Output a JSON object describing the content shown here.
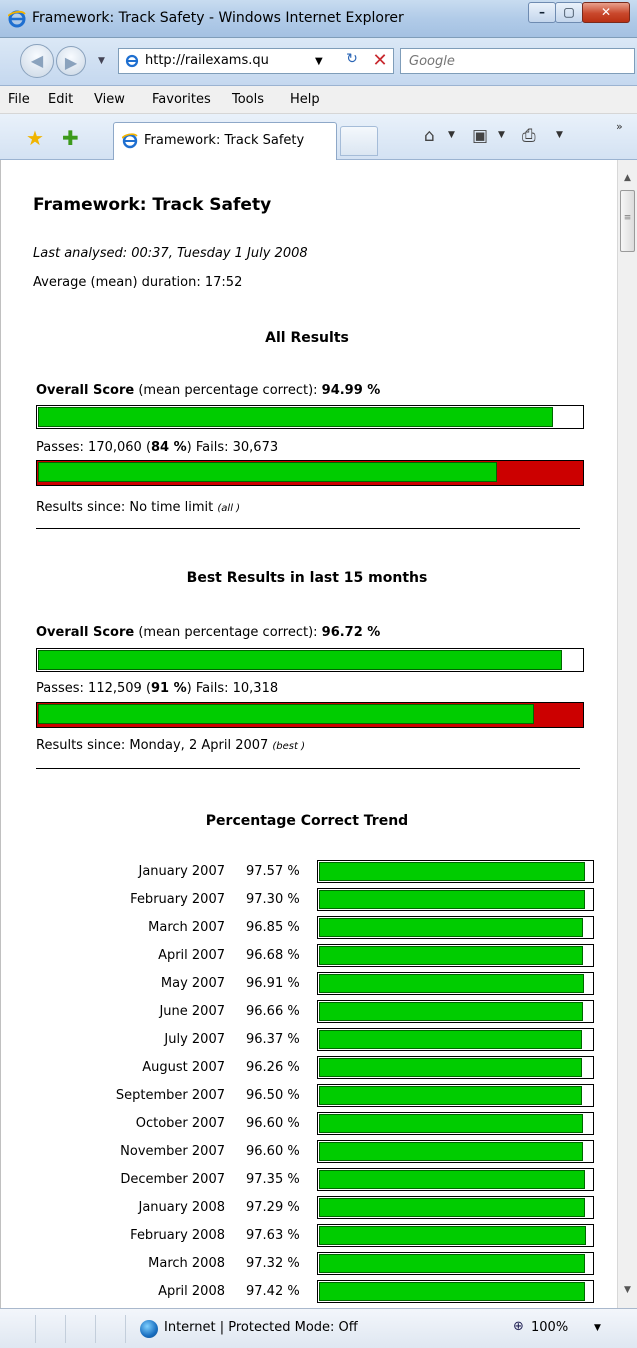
{
  "window": {
    "title": "Framework: Track Safety - Windows Internet Explorer",
    "minimize": "–",
    "maximize": "▢",
    "close": "✕"
  },
  "address": {
    "url": "http://railexams.qu",
    "search_placeholder": "Google"
  },
  "menu": {
    "items": [
      {
        "label": "File"
      },
      {
        "label": "Edit"
      },
      {
        "label": "View"
      },
      {
        "label": "Favorites"
      },
      {
        "label": "Tools"
      },
      {
        "label": "Help"
      }
    ]
  },
  "tab": {
    "label": "Framework: Track Safety"
  },
  "page": {
    "title": "Framework: Track Safety",
    "last_analysed": "Last analysed: 00:37, Tuesday 1 July 2008",
    "avg_duration": "Average (mean) duration: 17:52",
    "all_results": {
      "heading": "All Results",
      "score_label": "Overall Score",
      "score_suffix": " (mean percentage correct): ",
      "score_value": "94.99 %",
      "score_fraction": 0.9499,
      "passes_prefix": "Passes: 170,060 (",
      "passes_pct": "84 %",
      "fails_text": ")   Fails: 30,673",
      "pass_fraction": 0.847,
      "since_text": "Results since: No time limit ",
      "since_tag": "(all )"
    },
    "best_results": {
      "heading": "Best Results in last 15 months",
      "score_label": "Overall Score",
      "score_suffix": " (mean percentage correct): ",
      "score_value": "96.72 %",
      "score_fraction": 0.9672,
      "passes_prefix": "Passes: 112,509 (",
      "passes_pct": "91 %",
      "fails_text": ")   Fails: 10,318",
      "pass_fraction": 0.916,
      "since_text": "Results since: Monday, 2 April 2007 ",
      "since_tag": "(best )"
    },
    "trend": {
      "heading": "Percentage Correct Trend",
      "rows": [
        {
          "month": "January 2007",
          "pct": "97.57 %",
          "value": 97.57
        },
        {
          "month": "February 2007",
          "pct": "97.30 %",
          "value": 97.3
        },
        {
          "month": "March 2007",
          "pct": "96.85 %",
          "value": 96.85
        },
        {
          "month": "April 2007",
          "pct": "96.68 %",
          "value": 96.68
        },
        {
          "month": "May 2007",
          "pct": "96.91 %",
          "value": 96.91
        },
        {
          "month": "June 2007",
          "pct": "96.66 %",
          "value": 96.66
        },
        {
          "month": "July 2007",
          "pct": "96.37 %",
          "value": 96.37
        },
        {
          "month": "August 2007",
          "pct": "96.26 %",
          "value": 96.26
        },
        {
          "month": "September 2007",
          "pct": "96.50 %",
          "value": 96.5
        },
        {
          "month": "October 2007",
          "pct": "96.60 %",
          "value": 96.6
        },
        {
          "month": "November 2007",
          "pct": "96.60 %",
          "value": 96.6
        },
        {
          "month": "December 2007",
          "pct": "97.35 %",
          "value": 97.35
        },
        {
          "month": "January 2008",
          "pct": "97.29 %",
          "value": 97.29
        },
        {
          "month": "February 2008",
          "pct": "97.63 %",
          "value": 97.63
        },
        {
          "month": "March 2008",
          "pct": "97.32 %",
          "value": 97.32
        },
        {
          "month": "April 2008",
          "pct": "97.42 %",
          "value": 97.42
        }
      ]
    }
  },
  "status": {
    "zone_text": "Internet | Protected Mode: Off",
    "zoom": "100%"
  },
  "colors": {
    "bar_green": "#00cc00",
    "bar_red": "#cc0000"
  }
}
